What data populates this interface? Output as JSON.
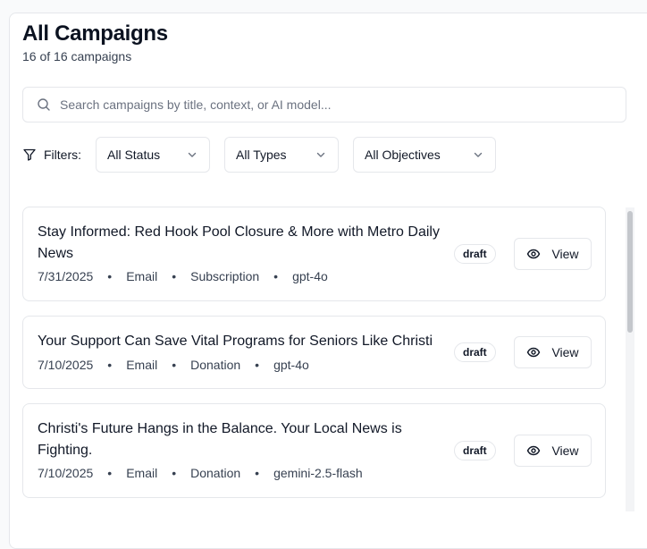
{
  "header": {
    "title": "All Campaigns",
    "subtitle": "16 of 16 campaigns"
  },
  "search": {
    "placeholder": "Search campaigns by title, context, or AI model...",
    "value": ""
  },
  "filters": {
    "label": "Filters:",
    "status": "All Status",
    "type": "All Types",
    "objective": "All Objectives"
  },
  "campaigns": [
    {
      "title": "Stay Informed: Red Hook Pool Closure & More with Metro Daily News",
      "date": "7/31/2025",
      "channel": "Email",
      "objective": "Subscription",
      "model": "gpt-4o",
      "status": "draft",
      "action": "View"
    },
    {
      "title": "Your Support Can Save Vital Programs for Seniors Like Christi",
      "date": "7/10/2025",
      "channel": "Email",
      "objective": "Donation",
      "model": "gpt-4o",
      "status": "draft",
      "action": "View"
    },
    {
      "title": "Christi's Future Hangs in the Balance. Your Local News is Fighting.",
      "date": "7/10/2025",
      "channel": "Email",
      "objective": "Donation",
      "model": "gemini-2.5-flash",
      "status": "draft",
      "action": "View"
    }
  ],
  "separator": "•",
  "colors": {
    "border": "#e5e7eb",
    "text": "#111827",
    "muted": "#374151"
  },
  "icons": {
    "search": "search-icon",
    "filter": "filter-icon",
    "chevron": "chevron-down-icon",
    "view": "eye-icon"
  }
}
